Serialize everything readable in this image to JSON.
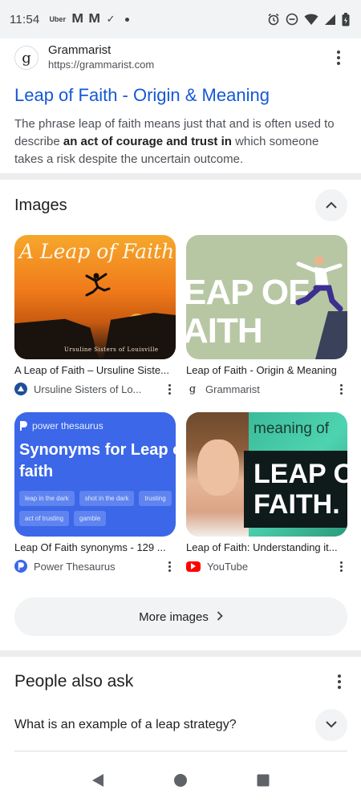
{
  "status_bar": {
    "time": "11:54",
    "notification_icons": [
      "uber-icon",
      "gmail-icon",
      "gmail-icon",
      "check-icon",
      "dot-icon"
    ],
    "uber_label": "Uber",
    "system_icons": [
      "alarm-icon",
      "dnd-icon",
      "wifi-icon",
      "signal-icon",
      "battery-icon"
    ]
  },
  "result": {
    "favicon_letter": "g",
    "site_name": "Grammarist",
    "site_url": "https://grammarist.com",
    "title": "Leap of Faith - Origin & Meaning",
    "snippet_pre": "The phrase leap of faith means just that and is often used to describe ",
    "snippet_bold": "an act of courage and trust in",
    "snippet_post": " which someone takes a risk despite the uncertain outcome."
  },
  "images_section": {
    "title": "Images",
    "items": [
      {
        "title": "A Leap of Faith – Ursuline Siste...",
        "source": "Ursuline Sisters of Lo...",
        "thumb_text": "A Leap of Faith",
        "thumb_logo": "Ursuline Sisters of Louisville"
      },
      {
        "title": "Leap of Faith - Origin & Meaning",
        "source": "Grammarist",
        "thumb_text_line1": "EAP OF",
        "thumb_text_line2": "AITH"
      },
      {
        "title": "Leap Of Faith synonyms - 129 ...",
        "source": "Power Thesaurus",
        "thumb_brand": "power thesaurus",
        "thumb_heading_line1": "Synonyms for Leap o",
        "thumb_heading_line2": "faith",
        "thumb_chips": [
          "leap in the dark",
          "shot in the dark",
          "trusting",
          "act of trusting",
          "gamble"
        ]
      },
      {
        "title": "Leap of Faith: Understanding it...",
        "source": "YouTube",
        "thumb_text_top": "meaning of",
        "thumb_text_line1": "LEAP O",
        "thumb_text_line2": "FAITH."
      }
    ],
    "more_label": "More images"
  },
  "people_also_ask": {
    "title": "People also ask",
    "questions": [
      "What is an example of a leap strategy?"
    ]
  },
  "colors": {
    "link": "#1558d6",
    "chip_bg": "#f1f3f4",
    "divider": "#ebedef",
    "power_thesaurus_blue": "#3b67e8",
    "youtube_red": "#ff0000"
  }
}
